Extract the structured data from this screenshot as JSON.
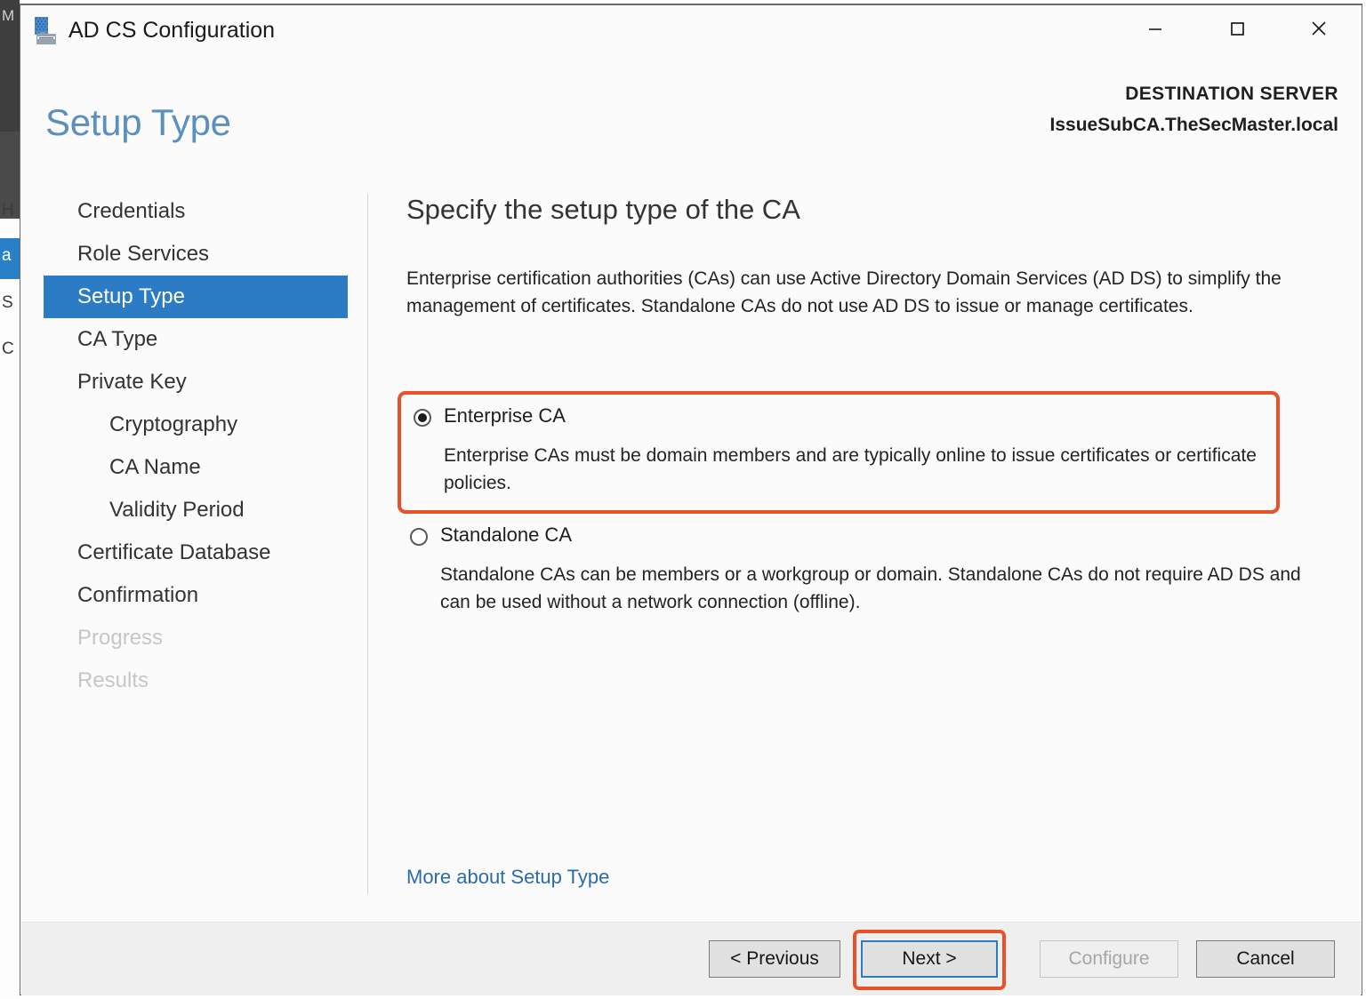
{
  "window": {
    "title": "AD CS Configuration",
    "icon": "adcs-toolbox-icon",
    "controls": {
      "minimize": "minimize-icon",
      "maximize": "maximize-icon",
      "close": "close-icon"
    }
  },
  "header": {
    "page_title": "Setup Type",
    "destination_label": "DESTINATION SERVER",
    "destination_value": "IssueSubCA.TheSecMaster.local"
  },
  "sidebar": {
    "items": [
      {
        "label": "Credentials",
        "state": "normal",
        "indent": false
      },
      {
        "label": "Role Services",
        "state": "normal",
        "indent": false
      },
      {
        "label": "Setup Type",
        "state": "active",
        "indent": false
      },
      {
        "label": "CA Type",
        "state": "normal",
        "indent": false
      },
      {
        "label": "Private Key",
        "state": "normal",
        "indent": false
      },
      {
        "label": "Cryptography",
        "state": "normal",
        "indent": true
      },
      {
        "label": "CA Name",
        "state": "normal",
        "indent": true
      },
      {
        "label": "Validity Period",
        "state": "normal",
        "indent": true
      },
      {
        "label": "Certificate Database",
        "state": "normal",
        "indent": false
      },
      {
        "label": "Confirmation",
        "state": "normal",
        "indent": false
      },
      {
        "label": "Progress",
        "state": "disabled",
        "indent": false
      },
      {
        "label": "Results",
        "state": "disabled",
        "indent": false
      }
    ]
  },
  "main": {
    "heading": "Specify the setup type of the CA",
    "description": "Enterprise certification authorities (CAs) can use Active Directory Domain Services (AD DS) to simplify the management of certificates. Standalone CAs do not use AD DS to issue or manage certificates.",
    "options": [
      {
        "label": "Enterprise CA",
        "selected": true,
        "highlighted": true,
        "description": "Enterprise CAs must be domain members and are typically online to issue certificates or certificate policies."
      },
      {
        "label": "Standalone CA",
        "selected": false,
        "highlighted": false,
        "description": "Standalone CAs can be members or a workgroup or domain. Standalone CAs do not require AD DS and can be used without a network connection (offline)."
      }
    ],
    "more_link": "More about Setup Type"
  },
  "footer": {
    "buttons": [
      {
        "label": "< Previous",
        "state": "normal",
        "highlighted": false
      },
      {
        "label": "Next >",
        "state": "focused",
        "highlighted": true
      },
      {
        "label": "Configure",
        "state": "disabled",
        "highlighted": false
      },
      {
        "label": "Cancel",
        "state": "normal",
        "highlighted": false
      }
    ]
  },
  "colors": {
    "accent_blue": "#2b7cc4",
    "title_blue": "#5b8fc0",
    "link_blue": "#2b6ca8",
    "highlight_orange": "#e8512a",
    "footer_gray": "#efefef"
  },
  "background_window": {
    "fragment_chars": [
      "M",
      "H",
      "a",
      "S",
      "C"
    ]
  }
}
